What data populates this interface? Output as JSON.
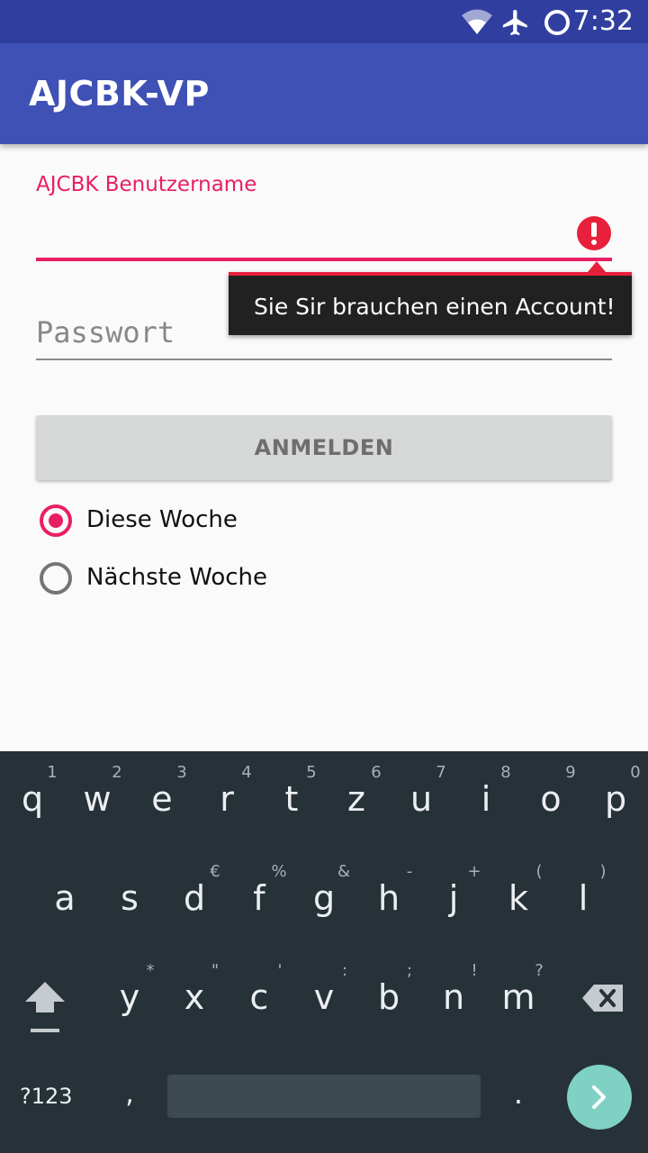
{
  "status_bar": {
    "time": "7:32",
    "icons": [
      "wifi-icon",
      "airplane-icon",
      "sync-icon"
    ]
  },
  "app_bar": {
    "title": "AJCBK-VP"
  },
  "form": {
    "username_label": "AJCBK Benutzername",
    "username_value": "",
    "error_message": "Sie Sir brauchen einen Account!",
    "password_placeholder": "Passwort",
    "password_value": "",
    "login_button": "ANMELDEN",
    "radio_options": [
      {
        "label": "Diese Woche",
        "checked": true
      },
      {
        "label": "Nächste Woche",
        "checked": false
      }
    ]
  },
  "keyboard": {
    "row1": [
      "q",
      "w",
      "e",
      "r",
      "t",
      "z",
      "u",
      "i",
      "o",
      "p"
    ],
    "row1_hints": [
      "1",
      "2",
      "3",
      "4",
      "5",
      "6",
      "7",
      "8",
      "9",
      "0"
    ],
    "row2": [
      "a",
      "s",
      "d",
      "f",
      "g",
      "h",
      "j",
      "k",
      "l"
    ],
    "row2_hints": [
      "",
      "",
      "€",
      "%",
      "&",
      "-",
      "+",
      "(",
      ")"
    ],
    "row3": [
      "y",
      "x",
      "c",
      "v",
      "b",
      "n",
      "m"
    ],
    "row3_hints": [
      "*",
      "\"",
      "'",
      ":",
      ";",
      "!",
      "?"
    ],
    "symbols_key": "?123",
    "comma_key": ",",
    "period_key": ".",
    "colors": {
      "background": "#263238",
      "enter": "#7fd1c3"
    }
  },
  "colors": {
    "primary": "#3f51b5",
    "primary_dark": "#303f9f",
    "accent": "#e91e63",
    "error": "#e8203b"
  }
}
